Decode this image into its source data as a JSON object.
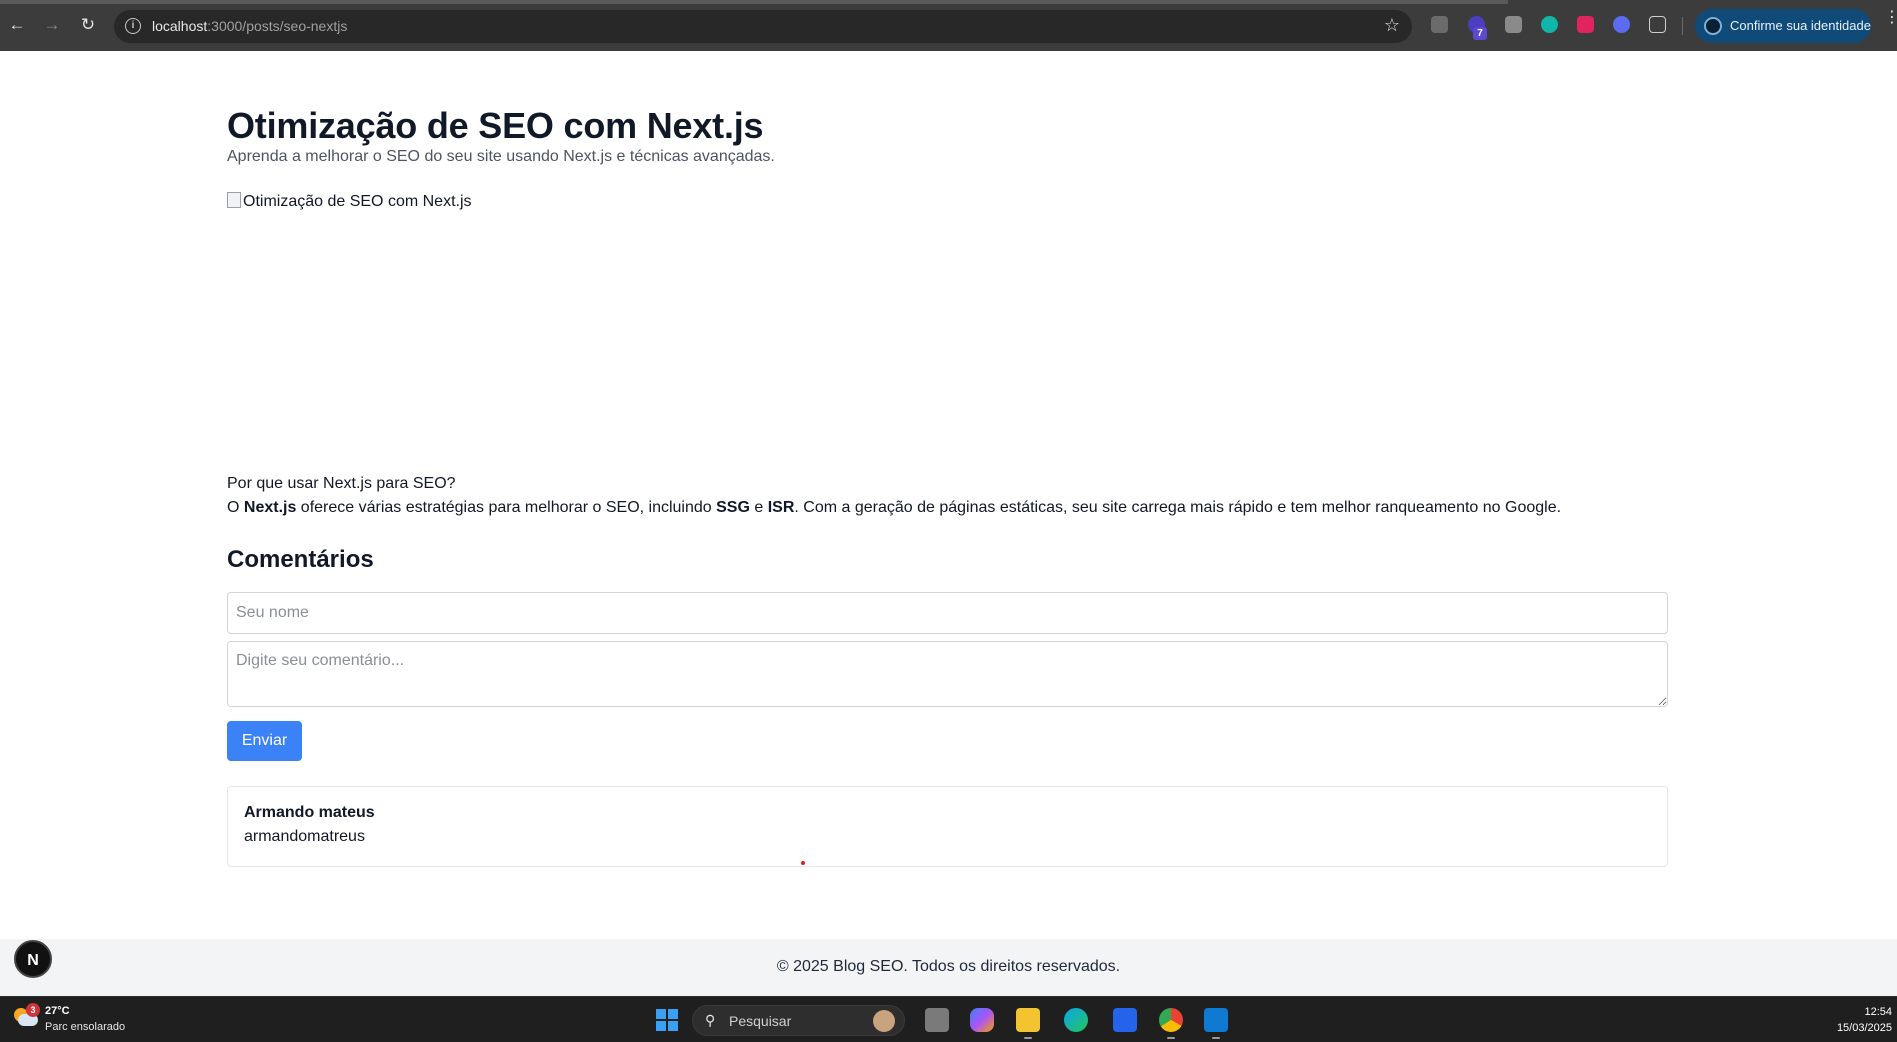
{
  "browser": {
    "url_host": "localhost",
    "url_rest": ":3000/posts/seo-nextjs",
    "profile_label": "Confirme sua identidade",
    "extension_badge": "7"
  },
  "post": {
    "title": "Otimização de SEO com Next.js",
    "subtitle": "Aprenda a melhorar o SEO do seu site usando Next.js e técnicas avançadas.",
    "image_alt": "Otimização de SEO com Next.js",
    "section_heading": "Por que usar Next.js para SEO?",
    "paragraph": {
      "p1": "O ",
      "b1": "Next.js",
      "p2": " oferece várias estratégias para melhorar o SEO, incluindo ",
      "b2": "SSG",
      "p3": " e ",
      "b3": "ISR",
      "p4": ". Com a geração de páginas estáticas, seu site carrega mais rápido e tem melhor ranqueamento no Google."
    }
  },
  "comments": {
    "title": "Comentários",
    "name_placeholder": "Seu nome",
    "comment_placeholder": "Digite seu comentário...",
    "submit_label": "Enviar",
    "items": [
      {
        "author": "Armando mateus",
        "text": "armandomatreus"
      }
    ]
  },
  "footer": {
    "text": "© 2025 Blog SEO. Todos os direitos reservados."
  },
  "next_badge": "N",
  "taskbar": {
    "weather_badge": "3",
    "temperature": "27°C",
    "weather_desc": "Parc ensolarado",
    "search_placeholder": "Pesquisar",
    "time": "12:54",
    "date": "15/03/2025"
  }
}
